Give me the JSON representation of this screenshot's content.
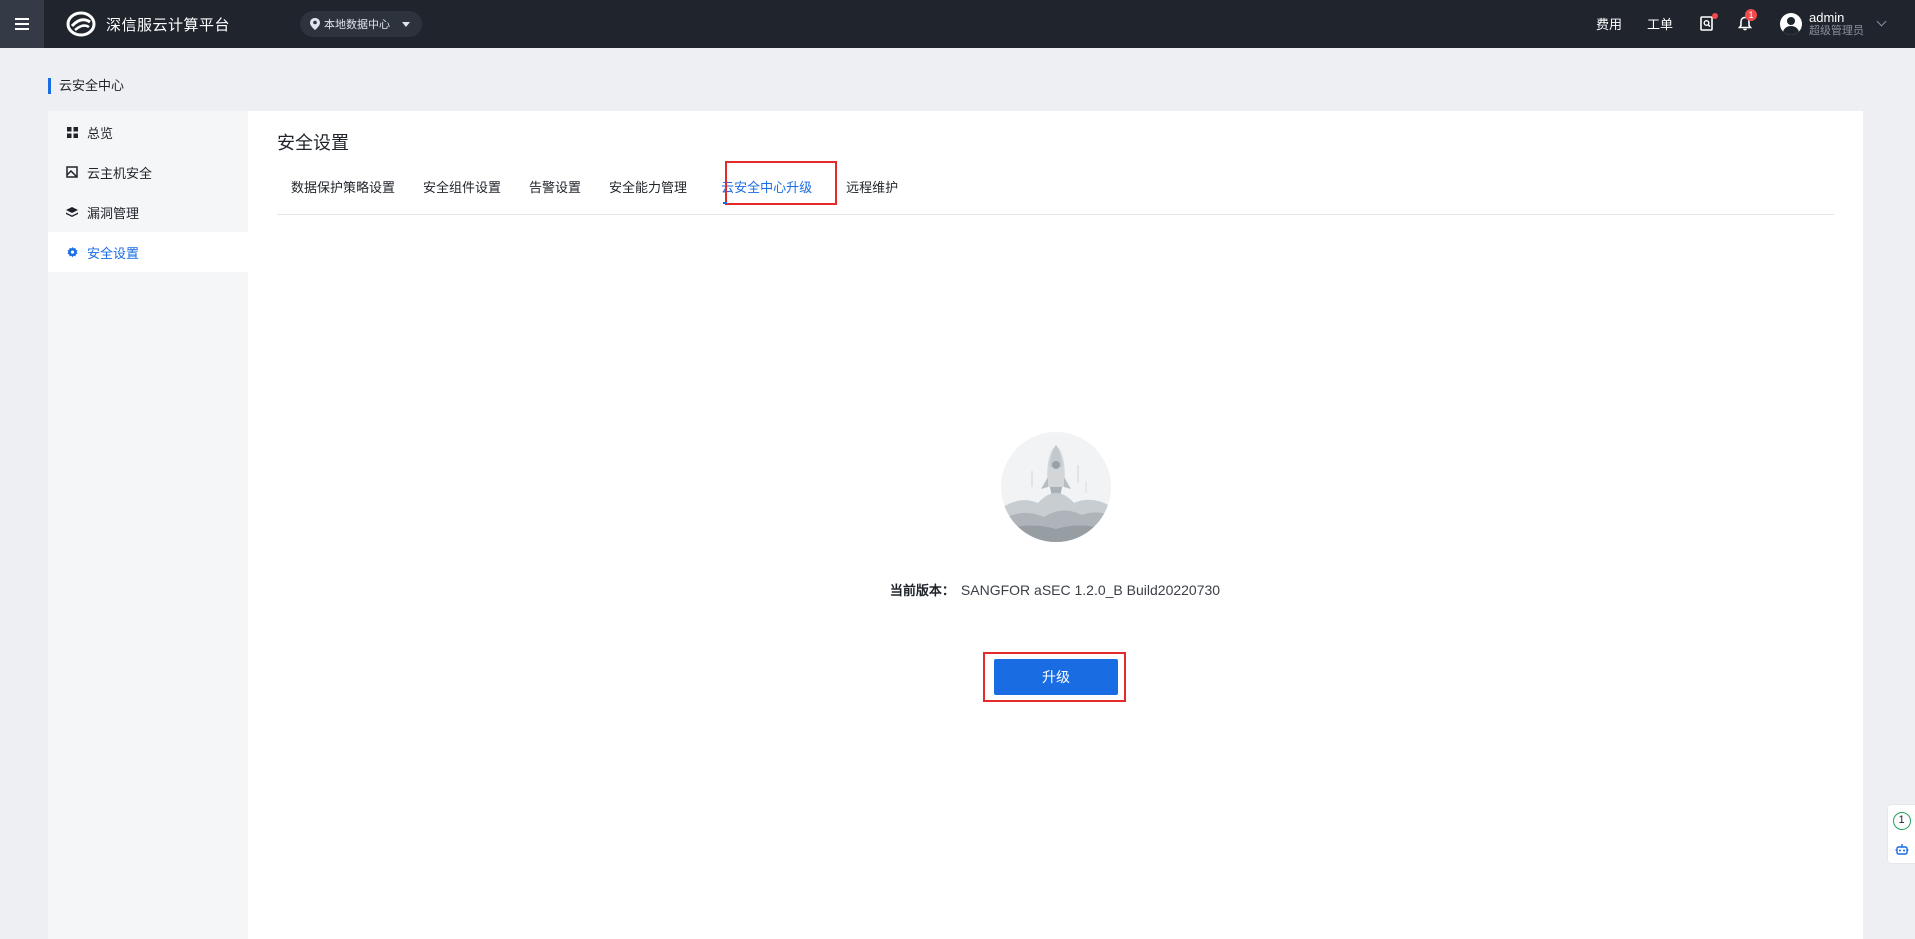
{
  "app": {
    "title": "深信服云计算平台",
    "datacenter": "本地数据中心"
  },
  "topbar": {
    "links": [
      "费用",
      "工单"
    ],
    "notification_count": "1",
    "user_name": "admin",
    "user_role": "超级管理员"
  },
  "breadcrumb": "云安全中心",
  "sidebar": {
    "items": [
      {
        "label": "总览",
        "icon": "grid-icon"
      },
      {
        "label": "云主机安全",
        "icon": "host-icon"
      },
      {
        "label": "漏洞管理",
        "icon": "layers-icon"
      },
      {
        "label": "安全设置",
        "icon": "gear-icon",
        "active": true
      }
    ]
  },
  "main": {
    "title": "安全设置",
    "tabs": [
      "数据保护策略设置",
      "安全组件设置",
      "告警设置",
      "安全能力管理",
      "云安全中心升级",
      "远程维护"
    ],
    "active_tab": "云安全中心升级",
    "version_label": "当前版本：",
    "version_value": "SANGFOR aSEC 1.2.0_B Build20220730",
    "upgrade_label": "升级"
  },
  "float_tools": {
    "badge": "1"
  },
  "colors": {
    "accent": "#1a6ce3",
    "topbar": "#1f242d",
    "highlight": "#e42a2a"
  }
}
